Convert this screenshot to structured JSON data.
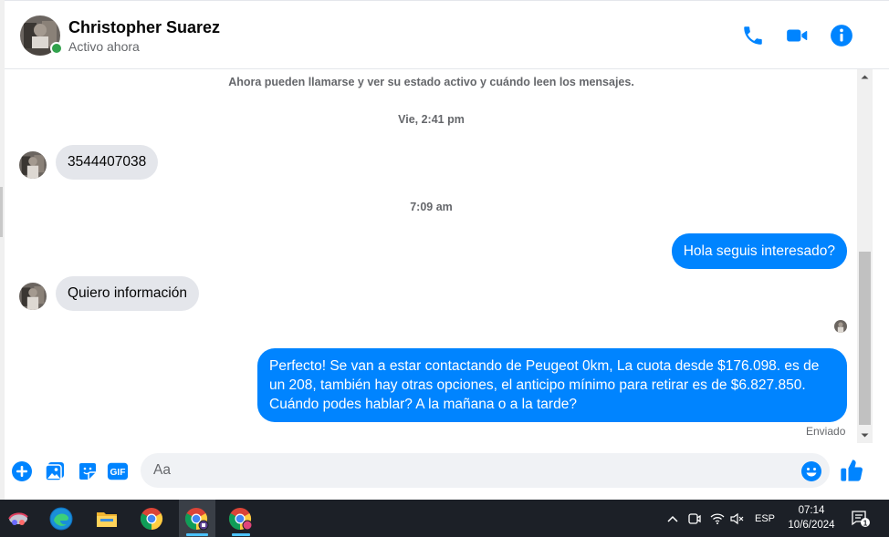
{
  "header": {
    "contact_name": "Christopher Suarez",
    "status": "Activo ahora",
    "icons": [
      "phone-icon",
      "video-call-icon",
      "info-icon"
    ]
  },
  "chat": {
    "system_notice": "Ahora pueden llamarse y ver su estado activo y cuándo leen los mensajes.",
    "timestamp_1": "Vie, 2:41 pm",
    "msg_in_1": "3544407038",
    "timestamp_2": "7:09 am",
    "msg_out_1": "Hola seguis interesado?",
    "msg_in_2": "Quiero información",
    "msg_out_2": "Perfecto!  Se van a estar contactando de Peugeot 0km, La cuota desde $176.098. es de un 208, también hay otras opciones, el anticipo mínimo para retirar es de $6.827.850. Cuándo podes hablar? A la mañana o a la tarde?",
    "sent_status": "Enviado"
  },
  "composer": {
    "placeholder": "Aa",
    "gif_label": "GIF"
  },
  "taskbar": {
    "language": "ESP",
    "time": "07:14",
    "date": "10/6/2024",
    "notification_count": "1"
  },
  "colors": {
    "accent": "#0084ff",
    "incoming_bubble": "#e4e6eb",
    "online": "#31a24c",
    "taskbar": "#1c2027"
  }
}
